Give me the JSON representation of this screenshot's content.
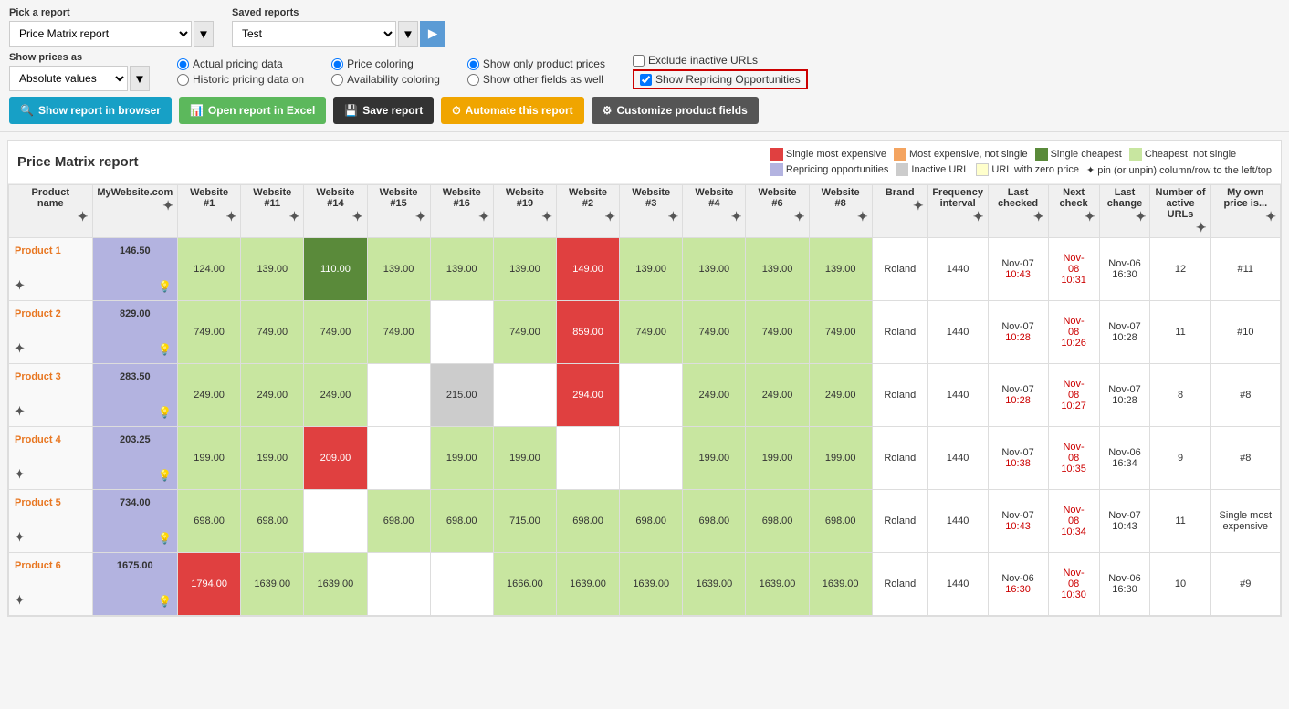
{
  "top": {
    "pick_report_label": "Pick a report",
    "saved_reports_label": "Saved reports",
    "report_selected": "Price Matrix report",
    "saved_selected": "Test",
    "show_prices_label": "Show prices as",
    "show_prices_value": "Absolute values",
    "pricing_options": [
      {
        "id": "actual",
        "label": "Actual pricing data",
        "checked": true
      },
      {
        "id": "historic",
        "label": "Historic pricing data on",
        "checked": false
      }
    ],
    "coloring_options": [
      {
        "id": "price_coloring",
        "label": "Price coloring",
        "checked": true
      },
      {
        "id": "avail_coloring",
        "label": "Availability coloring",
        "checked": false
      }
    ],
    "show_options": [
      {
        "id": "only_product",
        "label": "Show only product prices",
        "checked": true
      },
      {
        "id": "other_fields",
        "label": "Show other fields as well",
        "checked": false
      }
    ],
    "checkboxes": [
      {
        "id": "exclude_inactive",
        "label": "Exclude inactive URLs",
        "checked": false
      },
      {
        "id": "show_repricing",
        "label": "Show Repricing Opportunities",
        "checked": true
      }
    ],
    "buttons": [
      {
        "id": "show_browser",
        "label": "Show report in browser",
        "icon": "🔍",
        "class": "btn-blue"
      },
      {
        "id": "open_excel",
        "label": "Open report in Excel",
        "icon": "📊",
        "class": "btn-green"
      },
      {
        "id": "save_report",
        "label": "Save report",
        "icon": "💾",
        "class": "btn-dark"
      },
      {
        "id": "automate",
        "label": "Automate this report",
        "icon": "⏱",
        "class": "btn-orange"
      },
      {
        "id": "customize",
        "label": "Customize product fields",
        "icon": "⚙",
        "class": "btn-gray"
      }
    ]
  },
  "report": {
    "title": "Price Matrix report",
    "legend": [
      {
        "color": "#e04040",
        "label": "Single most expensive"
      },
      {
        "color": "#f4a460",
        "label": "Most expensive, not single"
      },
      {
        "color": "#5a8a3a",
        "label": "Single cheapest"
      },
      {
        "color": "#c8e6a0",
        "label": "Cheapest, not single"
      },
      {
        "color": "#b3b3e0",
        "label": "Repricing opportunities"
      },
      {
        "color": "#cccccc",
        "label": "Inactive URL"
      },
      {
        "color": "#ffffcc",
        "label": "URL with zero price"
      },
      {
        "pin_note": "✦ pin (or unpin) column/row to the left/top"
      }
    ],
    "columns": [
      {
        "id": "product_name",
        "label": "Product name"
      },
      {
        "id": "mywebsite",
        "label": "MyWebsite.com"
      },
      {
        "id": "w1",
        "label": "Website #1"
      },
      {
        "id": "w11",
        "label": "Website #11"
      },
      {
        "id": "w14",
        "label": "Website #14"
      },
      {
        "id": "w15",
        "label": "Website #15"
      },
      {
        "id": "w16",
        "label": "Website #16"
      },
      {
        "id": "w19",
        "label": "Website #19"
      },
      {
        "id": "w2",
        "label": "Website #2"
      },
      {
        "id": "w3",
        "label": "Website #3"
      },
      {
        "id": "w4",
        "label": "Website #4"
      },
      {
        "id": "w6",
        "label": "Website #6"
      },
      {
        "id": "w8",
        "label": "Website #8"
      },
      {
        "id": "brand",
        "label": "Brand"
      },
      {
        "id": "freq",
        "label": "Frequency interval"
      },
      {
        "id": "last_checked",
        "label": "Last checked"
      },
      {
        "id": "next_check",
        "label": "Next check"
      },
      {
        "id": "last_change",
        "label": "Last change"
      },
      {
        "id": "active_urls",
        "label": "Number of active URLs"
      },
      {
        "id": "my_price",
        "label": "My own price is..."
      }
    ],
    "products": [
      {
        "name": "Product 1",
        "mysite": "146.50",
        "w1": {
          "val": "124.00",
          "cls": "cell-green-light"
        },
        "w11": {
          "val": "139.00",
          "cls": "cell-green-light"
        },
        "w14": {
          "val": "110.00",
          "cls": "cell-green-dark"
        },
        "w15": {
          "val": "139.00",
          "cls": "cell-green-light"
        },
        "w16": {
          "val": "139.00",
          "cls": "cell-green-light"
        },
        "w19": {
          "val": "139.00",
          "cls": "cell-green-light"
        },
        "w2": {
          "val": "149.00",
          "cls": "cell-red"
        },
        "w3": {
          "val": "139.00",
          "cls": "cell-green-light"
        },
        "w4": {
          "val": "139.00",
          "cls": "cell-green-light"
        },
        "w6": {
          "val": "139.00",
          "cls": "cell-green-light"
        },
        "w8": {
          "val": "139.00",
          "cls": "cell-green-light"
        },
        "brand": "Roland",
        "freq": "1440",
        "last_checked": {
          "line1": "Nov-07",
          "line2": "10:43"
        },
        "next_check": {
          "line1": "Nov-",
          "line2": "08",
          "line3": "10:31"
        },
        "last_change": {
          "line1": "Nov-06",
          "line2": "16:30"
        },
        "active_urls": "12",
        "my_price": "#11"
      },
      {
        "name": "Product 2",
        "mysite": "829.00",
        "w1": {
          "val": "749.00",
          "cls": "cell-green-light"
        },
        "w11": {
          "val": "749.00",
          "cls": "cell-green-light"
        },
        "w14": {
          "val": "749.00",
          "cls": "cell-green-light"
        },
        "w15": {
          "val": "749.00",
          "cls": "cell-green-light"
        },
        "w16": {
          "val": "",
          "cls": "cell-default"
        },
        "w19": {
          "val": "749.00",
          "cls": "cell-green-light"
        },
        "w2": {
          "val": "859.00",
          "cls": "cell-red"
        },
        "w3": {
          "val": "749.00",
          "cls": "cell-green-light"
        },
        "w4": {
          "val": "749.00",
          "cls": "cell-green-light"
        },
        "w6": {
          "val": "749.00",
          "cls": "cell-green-light"
        },
        "w8": {
          "val": "749.00",
          "cls": "cell-green-light"
        },
        "brand": "Roland",
        "freq": "1440",
        "last_checked": {
          "line1": "Nov-07",
          "line2": "10:28"
        },
        "next_check": {
          "line1": "Nov-",
          "line2": "08",
          "line3": "10:26"
        },
        "last_change": {
          "line1": "Nov-07",
          "line2": "10:28"
        },
        "active_urls": "11",
        "my_price": "#10"
      },
      {
        "name": "Product 3",
        "mysite": "283.50",
        "w1": {
          "val": "249.00",
          "cls": "cell-green-light"
        },
        "w11": {
          "val": "249.00",
          "cls": "cell-green-light"
        },
        "w14": {
          "val": "249.00",
          "cls": "cell-green-light"
        },
        "w15": {
          "val": "",
          "cls": "cell-default"
        },
        "w16": {
          "val": "215.00",
          "cls": "cell-gray"
        },
        "w19": {
          "val": "",
          "cls": "cell-default"
        },
        "w2": {
          "val": "294.00",
          "cls": "cell-red"
        },
        "w3": {
          "val": "",
          "cls": "cell-default"
        },
        "w4": {
          "val": "249.00",
          "cls": "cell-green-light"
        },
        "w6": {
          "val": "249.00",
          "cls": "cell-green-light"
        },
        "w8": {
          "val": "249.00",
          "cls": "cell-green-light"
        },
        "brand": "Roland",
        "freq": "1440",
        "last_checked": {
          "line1": "Nov-07",
          "line2": "10:28"
        },
        "next_check": {
          "line1": "Nov-",
          "line2": "08",
          "line3": "10:27"
        },
        "last_change": {
          "line1": "Nov-07",
          "line2": "10:28"
        },
        "active_urls": "8",
        "my_price": "#8"
      },
      {
        "name": "Product 4",
        "mysite": "203.25",
        "w1": {
          "val": "199.00",
          "cls": "cell-green-light"
        },
        "w11": {
          "val": "199.00",
          "cls": "cell-green-light"
        },
        "w14": {
          "val": "209.00",
          "cls": "cell-red"
        },
        "w15": {
          "val": "",
          "cls": "cell-default"
        },
        "w16": {
          "val": "199.00",
          "cls": "cell-green-light"
        },
        "w19": {
          "val": "199.00",
          "cls": "cell-green-light"
        },
        "w2": {
          "val": "",
          "cls": "cell-default"
        },
        "w3": {
          "val": "",
          "cls": "cell-default"
        },
        "w4": {
          "val": "199.00",
          "cls": "cell-green-light"
        },
        "w6": {
          "val": "199.00",
          "cls": "cell-green-light"
        },
        "w8": {
          "val": "199.00",
          "cls": "cell-green-light"
        },
        "brand": "Roland",
        "freq": "1440",
        "last_checked": {
          "line1": "Nov-07",
          "line2": "10:38"
        },
        "next_check": {
          "line1": "Nov-",
          "line2": "08",
          "line3": "10:35"
        },
        "last_change": {
          "line1": "Nov-06",
          "line2": "16:34"
        },
        "active_urls": "9",
        "my_price": "#8"
      },
      {
        "name": "Product 5",
        "mysite": "734.00",
        "w1": {
          "val": "698.00",
          "cls": "cell-green-light"
        },
        "w11": {
          "val": "698.00",
          "cls": "cell-green-light"
        },
        "w14": {
          "val": "",
          "cls": "cell-default"
        },
        "w15": {
          "val": "698.00",
          "cls": "cell-green-light"
        },
        "w16": {
          "val": "698.00",
          "cls": "cell-green-light"
        },
        "w19": {
          "val": "715.00",
          "cls": "cell-green-light"
        },
        "w2": {
          "val": "698.00",
          "cls": "cell-green-light"
        },
        "w3": {
          "val": "698.00",
          "cls": "cell-green-light"
        },
        "w4": {
          "val": "698.00",
          "cls": "cell-green-light"
        },
        "w6": {
          "val": "698.00",
          "cls": "cell-green-light"
        },
        "w8": {
          "val": "698.00",
          "cls": "cell-green-light"
        },
        "brand": "Roland",
        "freq": "1440",
        "last_checked": {
          "line1": "Nov-07",
          "line2": "10:43"
        },
        "next_check": {
          "line1": "Nov-",
          "line2": "08",
          "line3": "10:34"
        },
        "last_change": {
          "line1": "Nov-07",
          "line2": "10:43"
        },
        "active_urls": "11",
        "my_price": "Single most expensive"
      },
      {
        "name": "Product 6",
        "mysite": "1675.00",
        "w1": {
          "val": "1794.00",
          "cls": "cell-red"
        },
        "w11": {
          "val": "1639.00",
          "cls": "cell-green-light"
        },
        "w14": {
          "val": "1639.00",
          "cls": "cell-green-light"
        },
        "w15": {
          "val": "",
          "cls": "cell-default"
        },
        "w16": {
          "val": "",
          "cls": "cell-default"
        },
        "w19": {
          "val": "1666.00",
          "cls": "cell-green-light"
        },
        "w2": {
          "val": "1639.00",
          "cls": "cell-green-light"
        },
        "w3": {
          "val": "1639.00",
          "cls": "cell-green-light"
        },
        "w4": {
          "val": "1639.00",
          "cls": "cell-green-light"
        },
        "w6": {
          "val": "1639.00",
          "cls": "cell-green-light"
        },
        "w8": {
          "val": "1639.00",
          "cls": "cell-green-light"
        },
        "brand": "Roland",
        "freq": "1440",
        "last_checked": {
          "line1": "Nov-06",
          "line2": "16:30"
        },
        "next_check": {
          "line1": "Nov-",
          "line2": "08",
          "line3": "10:30"
        },
        "last_change": {
          "line1": "Nov-06",
          "line2": "16:30"
        },
        "active_urls": "10",
        "my_price": "#9"
      }
    ]
  }
}
